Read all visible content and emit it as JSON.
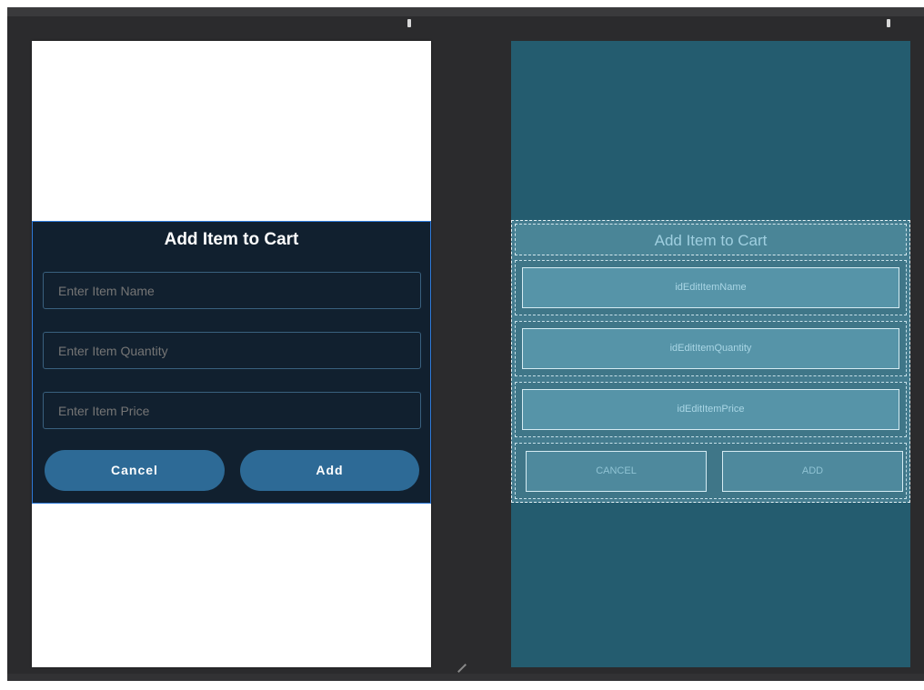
{
  "design_preview": {
    "dialog": {
      "title": "Add Item to Cart",
      "fields": [
        {
          "placeholder": "Enter Item Name"
        },
        {
          "placeholder": "Enter Item Quantity"
        },
        {
          "placeholder": "Enter Item Price"
        }
      ],
      "cancel_label": "Cancel",
      "add_label": "Add"
    }
  },
  "blueprint_preview": {
    "title": "Add Item to Cart",
    "field_ids": [
      "idEditItemName",
      "idEditItemQuantity",
      "idEditItemPrice"
    ],
    "cancel_label": "CANCEL",
    "add_label": "ADD"
  },
  "colors": {
    "editor_bg": "#2b2b2d",
    "dialog_bg": "#11202f",
    "button_bg": "#2d6a96",
    "blueprint_bg": "#245c6f"
  }
}
